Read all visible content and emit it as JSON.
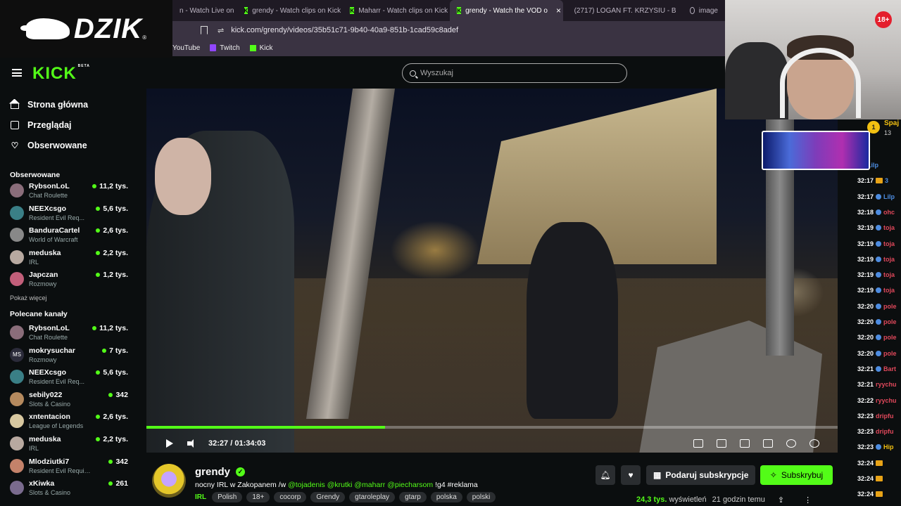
{
  "overlay": {
    "logo_text": "DZIK",
    "logo_reg": "®",
    "live_badge": "18+",
    "coin_value": "1",
    "coin_user": "Spaj",
    "coin_count": "13"
  },
  "browser": {
    "tabs": [
      {
        "label": "n - Watch Live on",
        "icon": "kick",
        "active": false
      },
      {
        "label": "grendy - Watch clips on Kick",
        "icon": "kick",
        "active": false
      },
      {
        "label": "Maharr - Watch clips on Kick",
        "icon": "kick",
        "active": false
      },
      {
        "label": "grendy - Watch the VOD o",
        "icon": "kick",
        "active": true
      },
      {
        "label": "(2717) LOGAN FT. KRZYSIU - B",
        "icon": "youtube",
        "active": false
      },
      {
        "label": "image",
        "icon": "globe",
        "active": false
      }
    ],
    "url": "kick.com/grendy/videos/35b51c71-9b40-40a9-851b-1cad59c8adef",
    "bookmarks": [
      "YouTube",
      "Twitch",
      "Kick"
    ]
  },
  "header": {
    "logo": "KICK",
    "logo_beta": "BETA",
    "search_placeholder": "Wyszukaj"
  },
  "sidebar": {
    "nav": [
      {
        "label": "Strona główna",
        "icon": "home-icon"
      },
      {
        "label": "Przeglądaj",
        "icon": "browse-icon"
      },
      {
        "label": "Obserwowane",
        "icon": "heart-icon"
      }
    ],
    "followed_title": "Obserwowane",
    "followed": [
      {
        "name": "RybsonLoL",
        "category": "Chat Roulette",
        "viewers": "11,2 tys.",
        "color": "#8a6d7a"
      },
      {
        "name": "NEEXcsgo",
        "category": "Resident Evil Req...",
        "viewers": "5,6 tys.",
        "color": "#3a7f86"
      },
      {
        "name": "BanduraCartel",
        "category": "World of Warcraft",
        "viewers": "2,6 tys.",
        "color": "#888888"
      },
      {
        "name": "meduska",
        "category": "IRL",
        "viewers": "2,2 tys.",
        "color": "#b8a9a0"
      },
      {
        "name": "Japczan",
        "category": "Rozmowy",
        "viewers": "1,2 tys.",
        "color": "#c25f7a"
      }
    ],
    "show_more": "Pokaż więcej",
    "recommended_title": "Polecane kanały",
    "recommended": [
      {
        "name": "RybsonLoL",
        "category": "Chat Roulette",
        "viewers": "11,2 tys.",
        "color": "#8a6d7a",
        "initials": ""
      },
      {
        "name": "mokrysuchar",
        "category": "Rozmowy",
        "viewers": "7 tys.",
        "color": "#2b2b3a",
        "initials": "MS"
      },
      {
        "name": "NEEXcsgo",
        "category": "Resident Evil Req...",
        "viewers": "5,6 tys.",
        "color": "#3a7f86",
        "initials": ""
      },
      {
        "name": "sebily022",
        "category": "Slots & Casino",
        "viewers": "342",
        "color": "#b58a5e",
        "initials": ""
      },
      {
        "name": "xntentacion",
        "category": "League of Legends",
        "viewers": "2,6 tys.",
        "color": "#d8c8a0",
        "initials": ""
      },
      {
        "name": "meduska",
        "category": "IRL",
        "viewers": "2,2 tys.",
        "color": "#b8a9a0",
        "initials": ""
      },
      {
        "name": "Mlodziutki7",
        "category": "Resident Evil Requiem",
        "viewers": "342",
        "color": "#c4826a",
        "initials": ""
      },
      {
        "name": "xKiwka",
        "category": "Slots & Casino",
        "viewers": "261",
        "color": "#7a6b8e",
        "initials": ""
      }
    ]
  },
  "player": {
    "current_time": "32:27",
    "separator": "/",
    "duration": "01:34:03",
    "progress_fraction": 0.345
  },
  "stream": {
    "streamer": "grendy",
    "title_prefix": "nocny IRL w Zakopanem /w",
    "mentions": "@tojadenis @krutki @maharr @piecharsom",
    "title_suffix": "!g4 #reklama",
    "category": "IRL",
    "tags": [
      "Polish",
      "18+",
      "cocorp",
      "Grendy",
      "gtaroleplay",
      "gtarp",
      "polska",
      "polski"
    ],
    "gift_label": "Podaruj subskrypcje",
    "subscribe_label": "Subskrybuj",
    "views_number": "24,3 tys.",
    "views_label": "wyświetleń",
    "time_ago": "21 godzin temu"
  },
  "chat": [
    {
      "time": "",
      "badge": "blue",
      "user": "Lilp",
      "color": "#4d8ce0"
    },
    {
      "time": "32:17",
      "badge": "gold",
      "user": "3",
      "color": "#4d8ce0"
    },
    {
      "time": "32:17",
      "badge": "blue",
      "user": "Lilp",
      "color": "#4d8ce0"
    },
    {
      "time": "32:18",
      "badge": "blue",
      "user": "ohc",
      "color": "#e0485b"
    },
    {
      "time": "32:19",
      "badge": "blue",
      "user": "toja",
      "color": "#e0485b"
    },
    {
      "time": "32:19",
      "badge": "blue",
      "user": "toja",
      "color": "#e0485b"
    },
    {
      "time": "32:19",
      "badge": "blue",
      "user": "toja",
      "color": "#e0485b"
    },
    {
      "time": "32:19",
      "badge": "blue",
      "user": "toja",
      "color": "#e0485b"
    },
    {
      "time": "32:19",
      "badge": "blue",
      "user": "toja",
      "color": "#e0485b"
    },
    {
      "time": "32:20",
      "badge": "blue",
      "user": "pole",
      "color": "#e0485b"
    },
    {
      "time": "32:20",
      "badge": "blue",
      "user": "pole",
      "color": "#e0485b"
    },
    {
      "time": "32:20",
      "badge": "blue",
      "user": "pole",
      "color": "#e0485b"
    },
    {
      "time": "32:20",
      "badge": "blue",
      "user": "pole",
      "color": "#e0485b"
    },
    {
      "time": "32:21",
      "badge": "blue",
      "user": "Bart",
      "color": "#e0485b"
    },
    {
      "time": "32:21",
      "badge": "none",
      "user": "ryychu",
      "color": "#e0485b"
    },
    {
      "time": "32:22",
      "badge": "none",
      "user": "ryychu",
      "color": "#e0485b"
    },
    {
      "time": "32:23",
      "badge": "none",
      "user": "dripfu",
      "color": "#e0485b"
    },
    {
      "time": "32:23",
      "badge": "none",
      "user": "dripfu",
      "color": "#e0485b"
    },
    {
      "time": "32:23",
      "badge": "blue",
      "user": "Hip",
      "color": "#f2c012"
    },
    {
      "time": "32:24",
      "badge": "gold",
      "user": "",
      "color": "#4d8ce0"
    },
    {
      "time": "32:24",
      "badge": "gold",
      "user": "",
      "color": "#4d8ce0"
    },
    {
      "time": "32:24",
      "badge": "gold",
      "user": "",
      "color": "#4d8ce0"
    }
  ],
  "colors": {
    "accent": "#53fc18",
    "background": "#0b0e0f"
  }
}
